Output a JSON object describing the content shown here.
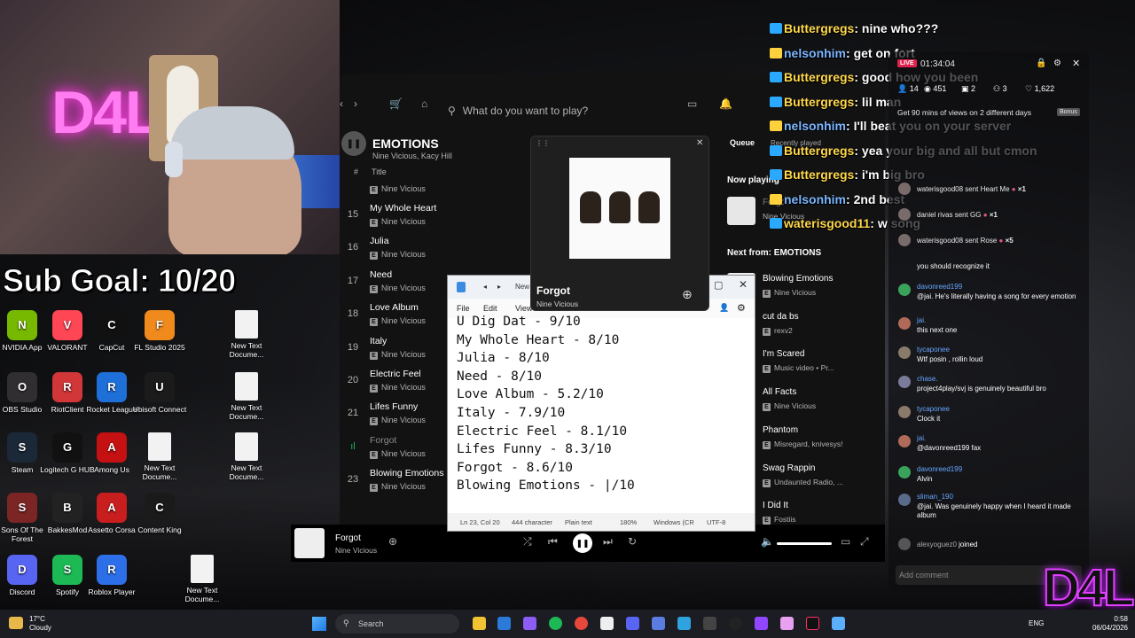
{
  "subgoal": "Sub Goal: 10/20",
  "desktop_icons": [
    {
      "label": "NVIDIA App",
      "color": "#76b900",
      "glyph": "N"
    },
    {
      "label": "VALORANT",
      "color": "#ff4655",
      "glyph": "V"
    },
    {
      "label": "CapCut",
      "color": "#111",
      "glyph": "C"
    },
    {
      "label": "FL Studio 2025",
      "color": "#f08a1c",
      "glyph": "F"
    },
    {
      "label": "New Text Docume...",
      "color": "doc",
      "glyph": ""
    },
    {
      "label": "OBS Studio",
      "color": "#302e31",
      "glyph": "O"
    },
    {
      "label": "RiotClient",
      "color": "#d13639",
      "glyph": "R"
    },
    {
      "label": "Rocket League",
      "color": "#1f6fd8",
      "glyph": "R"
    },
    {
      "label": "Ubisoft Connect",
      "color": "#1b1b1b",
      "glyph": "U"
    },
    {
      "label": "New Text Docume...",
      "color": "doc",
      "glyph": ""
    },
    {
      "label": "Steam",
      "color": "#1b2838",
      "glyph": "S"
    },
    {
      "label": "Logitech G HUB",
      "color": "#111",
      "glyph": "G"
    },
    {
      "label": "Among Us",
      "color": "#c51111",
      "glyph": "A"
    },
    {
      "label": "New Text Docume...",
      "color": "doc",
      "glyph": ""
    },
    {
      "label": "New Text Docume...",
      "color": "doc",
      "glyph": ""
    },
    {
      "label": "Sons Of The Forest",
      "color": "#7b2525",
      "glyph": "S"
    },
    {
      "label": "BakkesMod",
      "color": "#222",
      "glyph": "B"
    },
    {
      "label": "Assetto Corsa",
      "color": "#c81e1e",
      "glyph": "A"
    },
    {
      "label": "Content King",
      "color": "#1a1a1a",
      "glyph": "C"
    },
    {
      "label": "Discord",
      "color": "#5865f2",
      "glyph": "D"
    },
    {
      "label": "Spotify",
      "color": "#1db954",
      "glyph": "S"
    },
    {
      "label": "Roblox Player",
      "color": "#2d6fe8",
      "glyph": "R"
    },
    {
      "label": "New Text Docume...",
      "color": "doc",
      "glyph": ""
    }
  ],
  "spotify": {
    "search_placeholder": "What do you want to play?",
    "playlist_title": "EMOTIONS",
    "playlist_sub": "Nine Vicious, Kacy Hill",
    "col_title": "Title",
    "col_hash": "#",
    "tracks": [
      {
        "num": "15",
        "title": "My Whole Heart",
        "artist": "Nine Vicious"
      },
      {
        "num": "16",
        "title": "Julia",
        "artist": "Nine Vicious"
      },
      {
        "num": "17",
        "title": "Need",
        "artist": "Nine Vicious"
      },
      {
        "num": "18",
        "title": "Love Album",
        "artist": "Nine Vicious"
      },
      {
        "num": "19",
        "title": "Italy",
        "artist": "Nine Vicious"
      },
      {
        "num": "20",
        "title": "Electric Feel",
        "artist": "Nine Vicious"
      },
      {
        "num": "21",
        "title": "Lifes Funny",
        "artist": "Nine Vicious"
      },
      {
        "num": "",
        "title": "Forgot",
        "artist": "Nine Vicious"
      },
      {
        "num": "23",
        "title": "Blowing Emotions",
        "artist": "Nine Vicious"
      }
    ],
    "top_artist": "Nine Vicious",
    "queue_tab": "Queue",
    "recently_played": "Recently played",
    "now_playing_label": "Now playing",
    "now_playing": {
      "title": "Forgot",
      "artist": "Nine Vicious"
    },
    "next_from_label": "Next from: EMOTIONS",
    "queue": [
      {
        "title": "Blowing Emotions",
        "artist": "Nine Vicious"
      },
      {
        "title": "cut da bs",
        "artist": "rexv2"
      },
      {
        "title": "I'm Scared",
        "artist": "Music video • Pr..."
      },
      {
        "title": "All Facts",
        "artist": "Nine Vicious"
      },
      {
        "title": "Phantom",
        "artist": "Misregard, knivesys!"
      },
      {
        "title": "Swag Rappin",
        "artist": "Undaunted Radio, ..."
      },
      {
        "title": "I Did It",
        "artist": "Fostiis"
      }
    ],
    "player": {
      "title": "Forgot",
      "artist": "Nine Vicious"
    }
  },
  "mini_player": {
    "title": "Forgot",
    "artist": "Nine Vicious"
  },
  "notepad": {
    "menu": [
      "File",
      "Edit",
      "View"
    ],
    "tab_label": "New",
    "text": "U Dig Dat - 9/10\nMy Whole Heart - 8/10\nJulia - 8/10\nNeed - 8/10\nLove Album - 5.2/10\nItaly - 7.9/10\nElectric Feel - 8.1/10\nLifes Funny - 8.3/10\nForgot - 8.6/10\nBlowing Emotions - |/10",
    "status": {
      "pos": "Ln 23, Col 20",
      "chars": "444 character",
      "format": "Plain text",
      "zoom": "180%",
      "eol": "Windows (CR",
      "enc": "UTF-8"
    }
  },
  "chat_overlay": [
    {
      "user": "Buttergregs",
      "msg": "nine who???",
      "badge": "b2"
    },
    {
      "user": "nelsonhim",
      "msg": "get on fort",
      "badge": "b1"
    },
    {
      "user": "Buttergregs",
      "msg": "good how you been",
      "badge": "b2"
    },
    {
      "user": "Buttergregs",
      "msg": "lil man",
      "badge": "b2"
    },
    {
      "user": "nelsonhim",
      "msg": "I'll beat you on your server",
      "badge": "b1"
    },
    {
      "user": "Buttergregs",
      "msg": "yea your big and all but cmon",
      "badge": "b2"
    },
    {
      "user": "Buttergregs",
      "msg": "i'm big bro",
      "badge": "b2"
    },
    {
      "user": "nelsonhim",
      "msg": "2nd best",
      "badge": "b1"
    },
    {
      "user": "waterisgood11",
      "msg": "w song",
      "badge": "b2"
    }
  ],
  "stream_panel": {
    "live": "LIVE",
    "timer": "01:34:04",
    "stats": [
      "14",
      "451",
      "2",
      "3",
      "1,622"
    ],
    "goal_text": "Get 90 mins of views on 2 different days",
    "bonus": "Bonus",
    "gifts": [
      {
        "user": "waterisgood08",
        "text": "sent Heart Me",
        "count": "×1"
      },
      {
        "user": "daniel rivas",
        "text": "sent GG",
        "count": "×1"
      },
      {
        "user": "waterisgood08",
        "text": "sent Rose",
        "count": "×5"
      }
    ],
    "comments": [
      {
        "user": "",
        "msg": "you should recognize it"
      },
      {
        "user": "davonreed199",
        "msg": "@jai. He's literally having a song for every emotion"
      },
      {
        "user": "jai.",
        "msg": "this next one"
      },
      {
        "user": "tycaponee",
        "msg": "Wtf posin , rollin loud"
      },
      {
        "user": "chase.",
        "msg": "project4play/svj is genuinely beautiful bro"
      },
      {
        "user": "tycaponee",
        "msg": "Clock it"
      },
      {
        "user": "jai.",
        "msg": "@davonreed199 fax"
      },
      {
        "user": "davonreed199",
        "msg": "Alvin"
      },
      {
        "user": "sliman_190",
        "msg": "@jai. Was genuinely happy when I heard it made album"
      },
      {
        "user": "alexyoguez0",
        "msg": "joined"
      }
    ],
    "add_comment": "Add comment"
  },
  "logo": "D4L",
  "taskbar": {
    "temp": "17°C",
    "weather": "Cloudy",
    "search": "Search",
    "lang": "ENG",
    "time": "0:58",
    "date": "06/04/2026"
  }
}
